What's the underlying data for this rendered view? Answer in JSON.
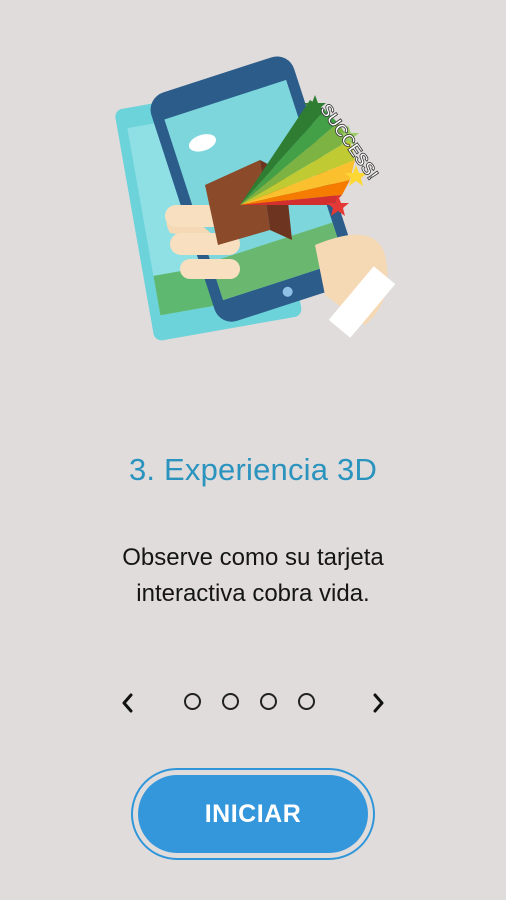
{
  "slide": {
    "title": "3. Experiencia 3D",
    "description_line1": "Observe como su tarjeta",
    "description_line2": "interactiva cobra vida.",
    "illustration_text": "SUCCESS!"
  },
  "pager": {
    "prev_icon": "chevron-left-icon",
    "next_icon": "chevron-right-icon",
    "total_pages": 4,
    "active_page": null
  },
  "actions": {
    "start_label": "INICIAR"
  },
  "colors": {
    "background": "#e0dcdc",
    "title": "#2a93be",
    "button": "#3497db"
  }
}
